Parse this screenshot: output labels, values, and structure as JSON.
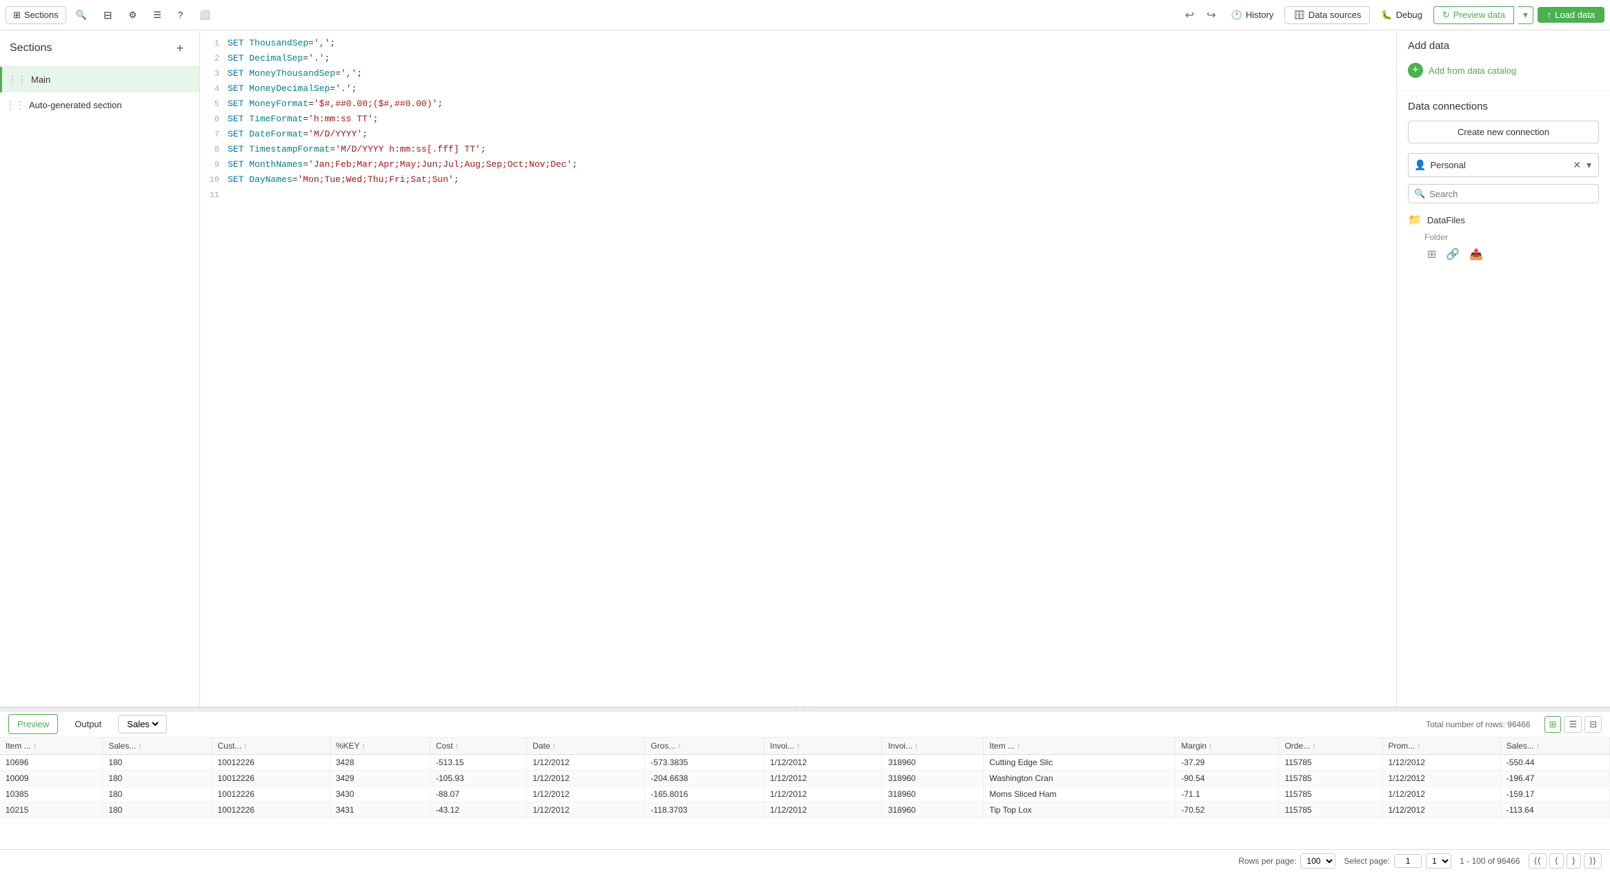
{
  "toolbar": {
    "sections_label": "Sections",
    "history_label": "History",
    "data_sources_label": "Data sources",
    "debug_label": "Debug",
    "preview_data_label": "Preview data",
    "load_data_label": "Load data"
  },
  "sidebar": {
    "title": "Sections",
    "items": [
      {
        "label": "Main",
        "active": true
      },
      {
        "label": "Auto-generated section",
        "active": false
      }
    ]
  },
  "editor": {
    "lines": [
      {
        "num": 1,
        "content": "SET ThousandSep=',';"
      },
      {
        "num": 2,
        "content": "SET DecimalSep='.';"
      },
      {
        "num": 3,
        "content": "SET MoneyThousandSep=',';"
      },
      {
        "num": 4,
        "content": "SET MoneyDecimalSep='.';"
      },
      {
        "num": 5,
        "content": "SET MoneyFormat='$#,##0.00;($#,##0.00)';"
      },
      {
        "num": 6,
        "content": "SET TimeFormat='h:mm:ss TT';"
      },
      {
        "num": 7,
        "content": "SET DateFormat='M/D/YYYY';"
      },
      {
        "num": 8,
        "content": "SET TimestampFormat='M/D/YYYY h:mm:ss[.fff] TT';"
      },
      {
        "num": 9,
        "content": "SET MonthNames='Jan;Feb;Mar;Apr;May;Jun;Jul;Aug;Sep;Oct;Nov;Dec';"
      },
      {
        "num": 10,
        "content": "SET DayNames='Mon;Tue;Wed;Thu;Fri;Sat;Sun';"
      },
      {
        "num": 11,
        "content": ""
      }
    ]
  },
  "right_panel": {
    "add_data_heading": "Add data",
    "add_from_catalog_label": "Add from data catalog",
    "data_connections_heading": "Data connections",
    "create_new_connection_label": "Create new connection",
    "personal_label": "Personal",
    "search_placeholder": "Search",
    "datafiles_label": "DataFiles",
    "folder_label": "Folder"
  },
  "bottom": {
    "preview_tab": "Preview",
    "output_tab": "Output",
    "table_name": "Sales",
    "row_count_label": "Total number of rows: 96466",
    "columns": [
      "Item ...",
      "Sales...",
      "Cust...",
      "%KEY",
      "Cost",
      "Date",
      "Gros...",
      "Invoi...",
      "Invoi...",
      "Item ...",
      "Margin",
      "Orde...",
      "Prom...",
      "Sales..."
    ],
    "rows": [
      [
        "10696",
        "180",
        "10012226",
        "3428",
        "-513.15",
        "1/12/2012",
        "-573.3835",
        "1/12/2012",
        "318960",
        "Cutting Edge Slic",
        "-37.29",
        "115785",
        "1/12/2012",
        "-550.44"
      ],
      [
        "10009",
        "180",
        "10012226",
        "3429",
        "-105.93",
        "1/12/2012",
        "-204.6638",
        "1/12/2012",
        "318960",
        "Washington Cran",
        "-90.54",
        "115785",
        "1/12/2012",
        "-196.47"
      ],
      [
        "10385",
        "180",
        "10012226",
        "3430",
        "-88.07",
        "1/12/2012",
        "-165.8016",
        "1/12/2012",
        "318960",
        "Moms Sliced Ham",
        "-71.1",
        "115785",
        "1/12/2012",
        "-159.17"
      ],
      [
        "10215",
        "180",
        "10012226",
        "3431",
        "-43.12",
        "1/12/2012",
        "-118.3703",
        "1/12/2012",
        "318960",
        "Tip Top Lox",
        "-70.52",
        "115785",
        "1/12/2012",
        "-113.64"
      ]
    ],
    "rows_per_page_label": "Rows per page:",
    "rows_per_page_value": "100",
    "select_page_label": "Select page:",
    "current_page": "1",
    "page_range": "1 - 100 of 96466",
    "total_rows": "96466"
  }
}
